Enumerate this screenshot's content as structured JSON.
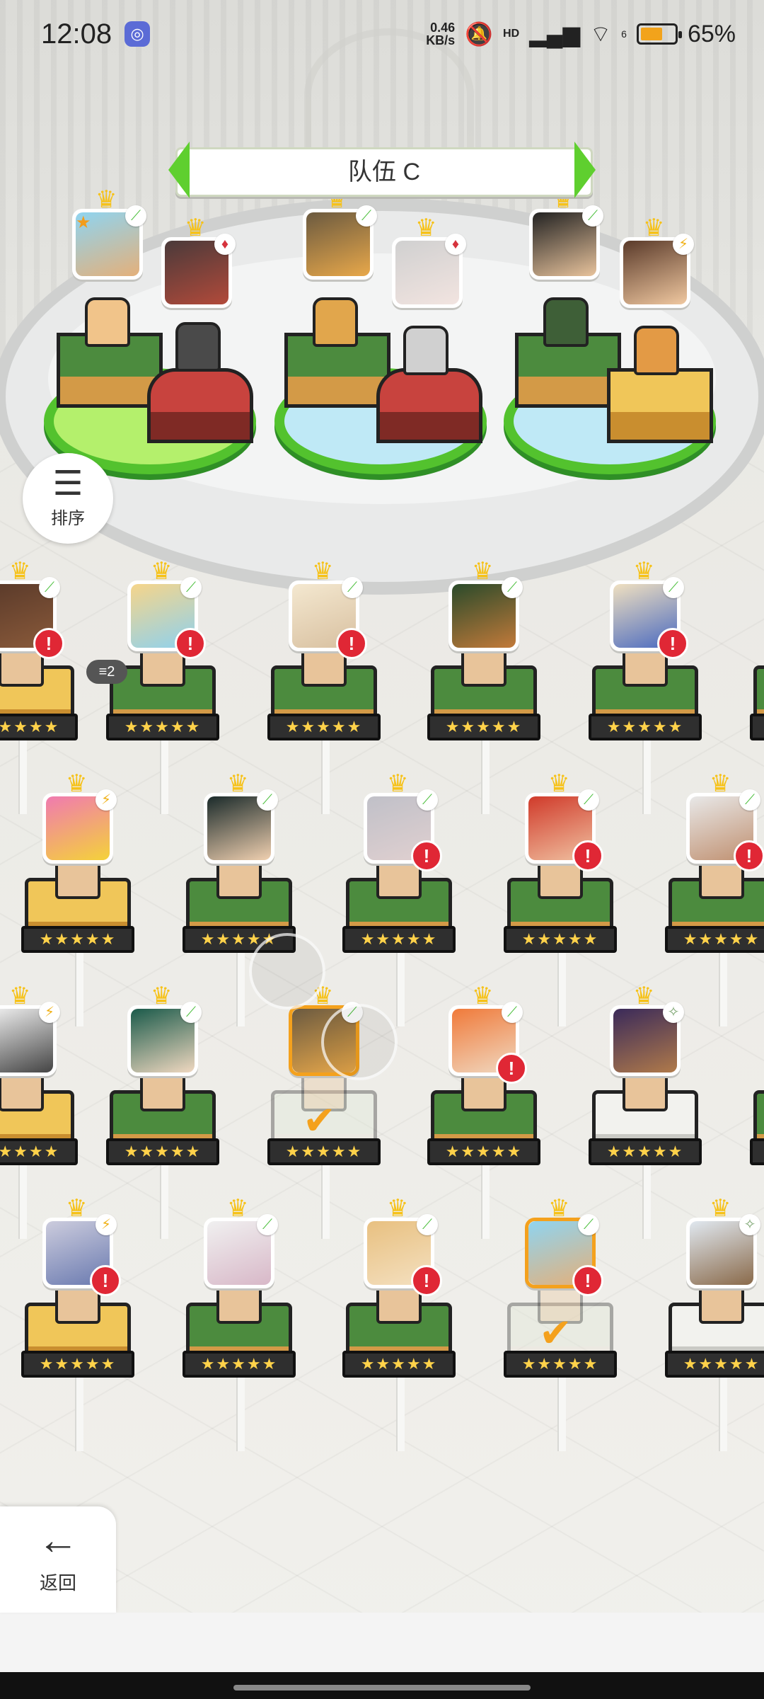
{
  "status_bar": {
    "time": "12:08",
    "net_speed_value": "0.46",
    "net_speed_unit": "KB/s",
    "network": "HD",
    "wifi_label": "6",
    "battery_percent": "65%",
    "battery_level": 0.65,
    "battery_color": "#f2a31b"
  },
  "team": {
    "name": "队伍 C",
    "accent_color": "#5fcf2f"
  },
  "buttons": {
    "sort_label": "排序",
    "back_label": "返回"
  },
  "roster": {
    "count_badge": "2",
    "stars": "★★★★★"
  },
  "icons": {
    "sort": "sort-icon",
    "back": "arrow-left-icon",
    "crown": "crown-icon",
    "alert": "alert-icon",
    "check": "check-icon"
  },
  "alert_glyph": "!"
}
